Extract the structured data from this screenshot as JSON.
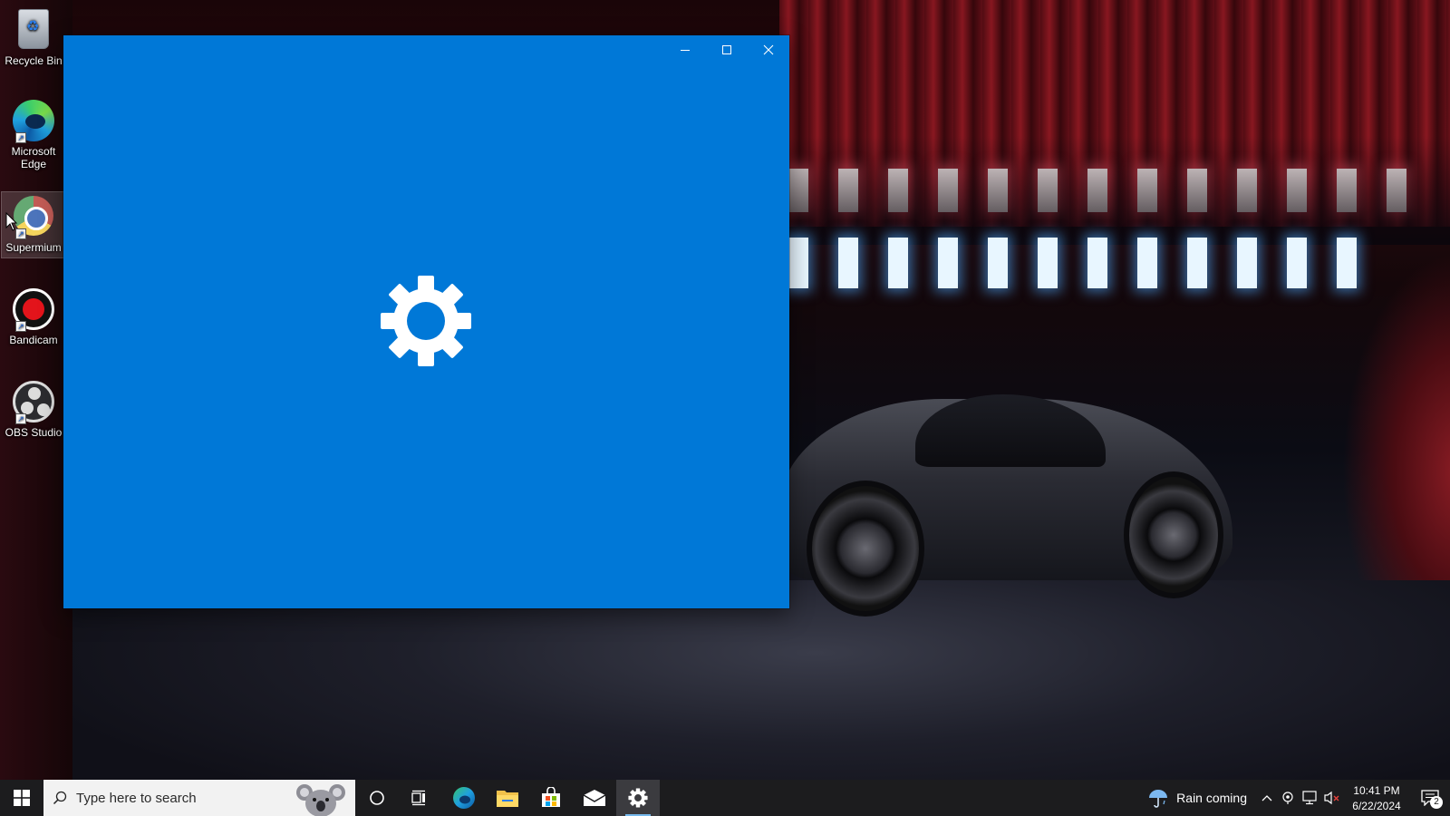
{
  "desktop": {
    "icons": [
      {
        "label": "Recycle Bin",
        "icon": "recycle-bin-icon"
      },
      {
        "label": "Microsoft Edge",
        "icon": "edge-icon"
      },
      {
        "label": "Supermium",
        "icon": "supermium-icon"
      },
      {
        "label": "Bandicam",
        "icon": "bandicam-icon"
      },
      {
        "label": "OBS Studio",
        "icon": "obs-studio-icon"
      }
    ]
  },
  "app_window": {
    "background_color": "#0078d7",
    "splash_icon": "gear-icon",
    "controls": {
      "minimize": "minimize-icon",
      "maximize": "maximize-icon",
      "close": "close-icon"
    }
  },
  "taskbar": {
    "search_placeholder": "Type here to search",
    "pinned": [
      {
        "name": "cortana",
        "icon": "cortana-circle-icon"
      },
      {
        "name": "task-view",
        "icon": "task-view-icon"
      },
      {
        "name": "edge",
        "icon": "edge-icon"
      },
      {
        "name": "file-explorer",
        "icon": "folder-icon"
      },
      {
        "name": "microsoft-store",
        "icon": "store-icon"
      },
      {
        "name": "mail",
        "icon": "mail-icon"
      },
      {
        "name": "settings",
        "icon": "gear-icon",
        "active": true
      }
    ],
    "weather": {
      "text": "Rain coming",
      "icon": "rain-umbrella-icon"
    },
    "clock": {
      "time": "10:41 PM",
      "date": "6/22/2024"
    },
    "notifications": {
      "count": "2"
    }
  },
  "colors": {
    "accent": "#0078d7",
    "taskbar": "#1c1c1e",
    "active_indicator": "#76b9ed"
  }
}
